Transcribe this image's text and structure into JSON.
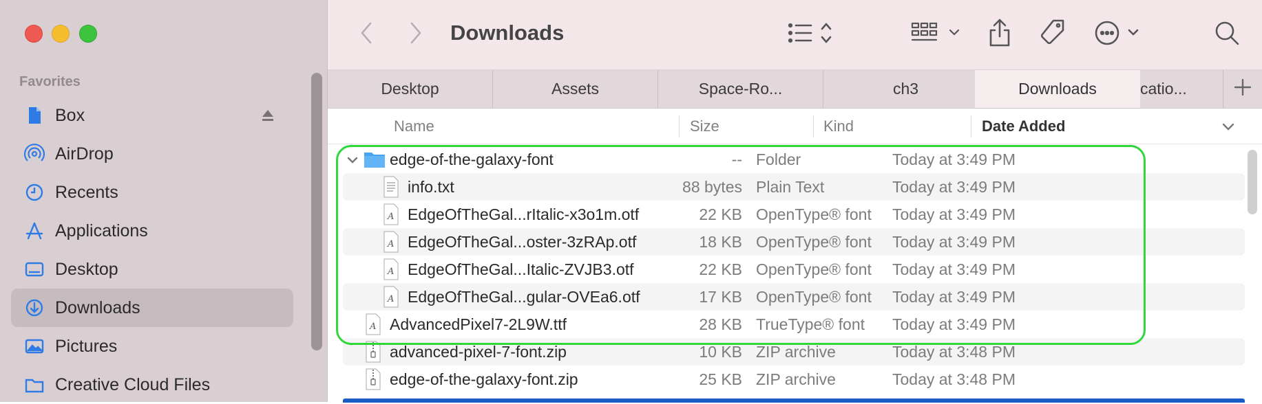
{
  "window": {
    "title": "Downloads"
  },
  "sidebar": {
    "section": "Favorites",
    "items": [
      {
        "label": "Box",
        "icon": "document-icon"
      },
      {
        "label": "AirDrop",
        "icon": "airdrop-icon"
      },
      {
        "label": "Recents",
        "icon": "clock-icon"
      },
      {
        "label": "Applications",
        "icon": "applications-icon"
      },
      {
        "label": "Desktop",
        "icon": "desktop-icon"
      },
      {
        "label": "Downloads",
        "icon": "download-icon",
        "selected": true
      },
      {
        "label": "Pictures",
        "icon": "pictures-icon"
      },
      {
        "label": "Creative Cloud Files",
        "icon": "folder-icon"
      }
    ]
  },
  "tabs": [
    {
      "label": "Desktop"
    },
    {
      "label": "Assets"
    },
    {
      "label": "Space-Ro..."
    },
    {
      "label": "ch3"
    },
    {
      "label": "Downloads",
      "active": true
    },
    {
      "label": "catio..."
    }
  ],
  "columns": {
    "name": "Name",
    "size": "Size",
    "kind": "Kind",
    "date": "Date Added"
  },
  "rows": [
    {
      "name": "edge-of-the-galaxy-font",
      "size": "--",
      "kind": "Folder",
      "date": "Today at 3:49 PM",
      "type": "folder"
    },
    {
      "name": "info.txt",
      "size": "88 bytes",
      "kind": "Plain Text",
      "date": "Today at 3:49 PM",
      "type": "text"
    },
    {
      "name": "EdgeOfTheGal...rItalic-x3o1m.otf",
      "size": "22 KB",
      "kind": "OpenType® font",
      "date": "Today at 3:49 PM",
      "type": "font"
    },
    {
      "name": "EdgeOfTheGal...oster-3zRAp.otf",
      "size": "18 KB",
      "kind": "OpenType® font",
      "date": "Today at 3:49 PM",
      "type": "font"
    },
    {
      "name": "EdgeOfTheGal...Italic-ZVJB3.otf",
      "size": "22 KB",
      "kind": "OpenType® font",
      "date": "Today at 3:49 PM",
      "type": "font"
    },
    {
      "name": "EdgeOfTheGal...gular-OVEa6.otf",
      "size": "17 KB",
      "kind": "OpenType® font",
      "date": "Today at 3:49 PM",
      "type": "font"
    },
    {
      "name": "AdvancedPixel7-2L9W.ttf",
      "size": "28 KB",
      "kind": "TrueType® font",
      "date": "Today at 3:49 PM",
      "type": "font"
    },
    {
      "name": "advanced-pixel-7-font.zip",
      "size": "10 KB",
      "kind": "ZIP archive",
      "date": "Today at 3:48 PM",
      "type": "zip"
    },
    {
      "name": "edge-of-the-galaxy-font.zip",
      "size": "25 KB",
      "kind": "ZIP archive",
      "date": "Today at 3:48 PM",
      "type": "zip"
    }
  ],
  "colors": {
    "highlight": "#2ed73a",
    "accent": "#1a5cc6",
    "folder": "#4aa3f0"
  }
}
